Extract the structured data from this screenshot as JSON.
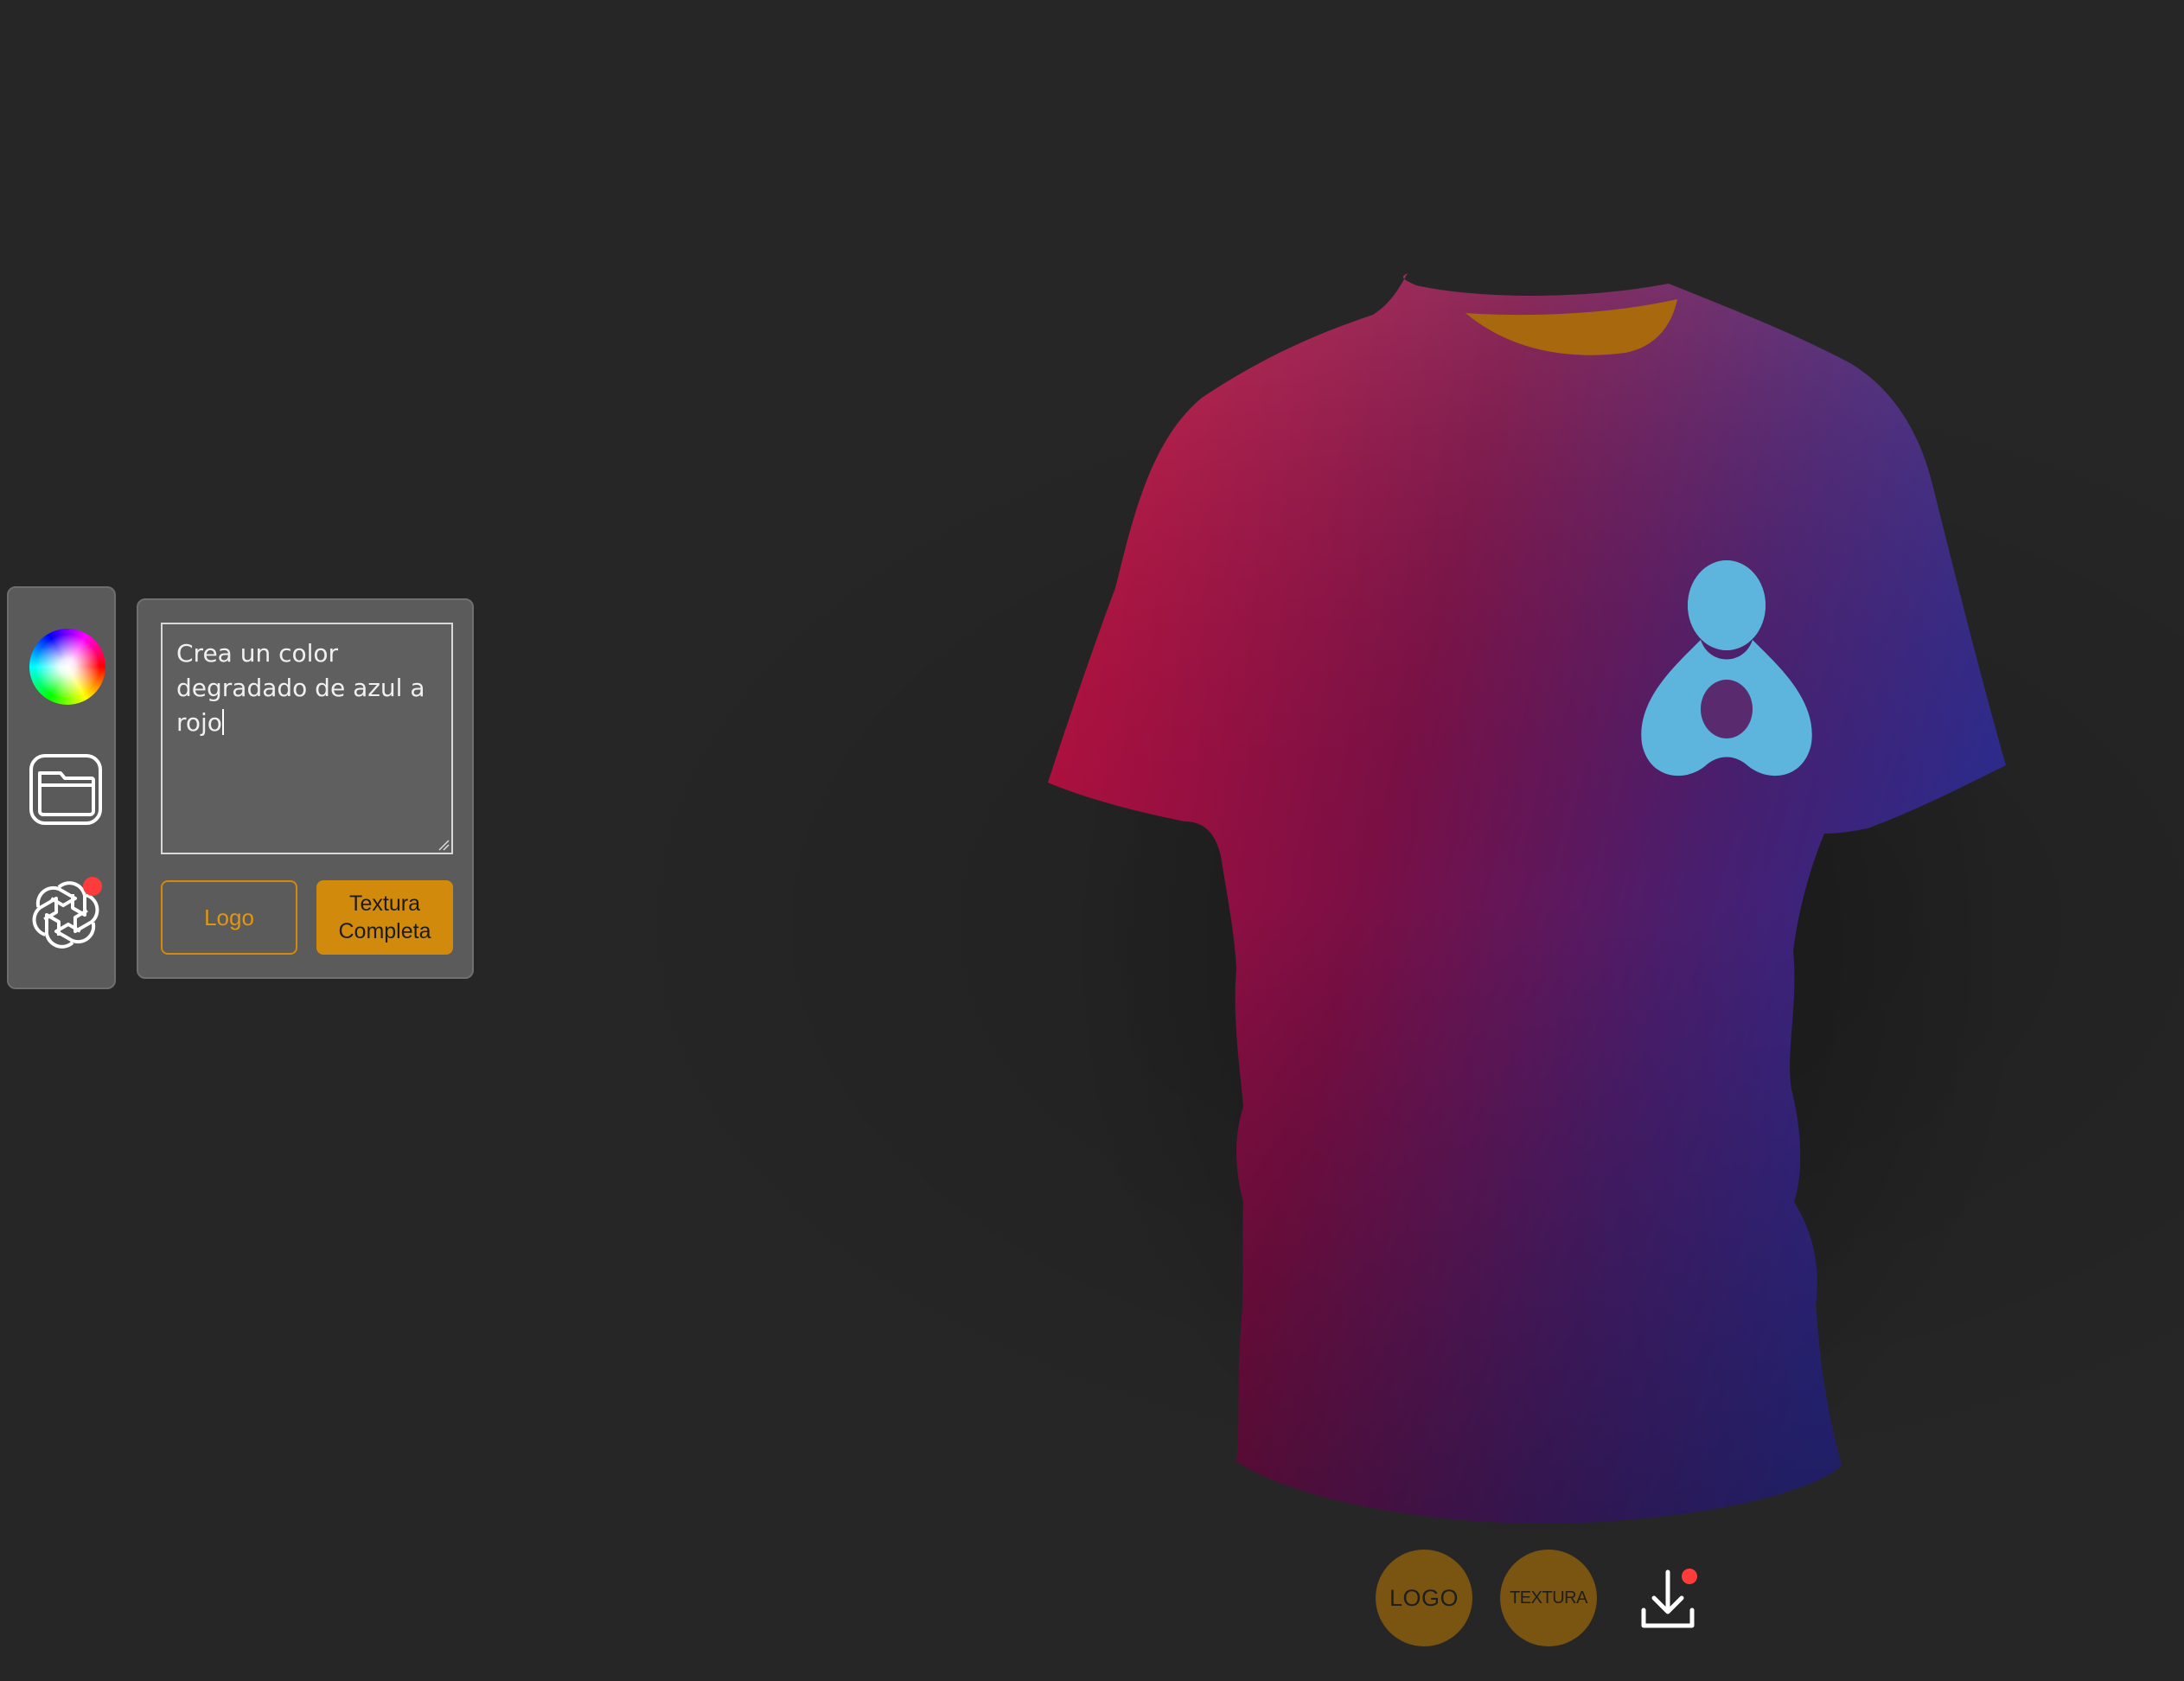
{
  "app": {
    "background_color": "#262626",
    "accent_color": "#d28a0c"
  },
  "tool_rail": {
    "items": [
      {
        "icon": "color-wheel-icon",
        "has_notification": false
      },
      {
        "icon": "folder-icon",
        "has_notification": false
      },
      {
        "icon": "openai-icon",
        "has_notification": true
      }
    ]
  },
  "ai_panel": {
    "prompt_value": "Crea un color degradado de azul a rojo",
    "logo_button_label": "Logo",
    "texture_button_label": "Textura Completa"
  },
  "shirt": {
    "gradient_colors": [
      "#c3103c",
      "#7a0036",
      "#2d2a8c"
    ],
    "collar_color": "#a8680e",
    "decal_icon": "logo-decal-icon",
    "decal_color": "#5db4dc"
  },
  "bottom_bar": {
    "logo_toggle_label": "LOGO",
    "texture_toggle_label": "TEXTURA",
    "download_icon": "download-icon",
    "download_has_notification": true
  }
}
